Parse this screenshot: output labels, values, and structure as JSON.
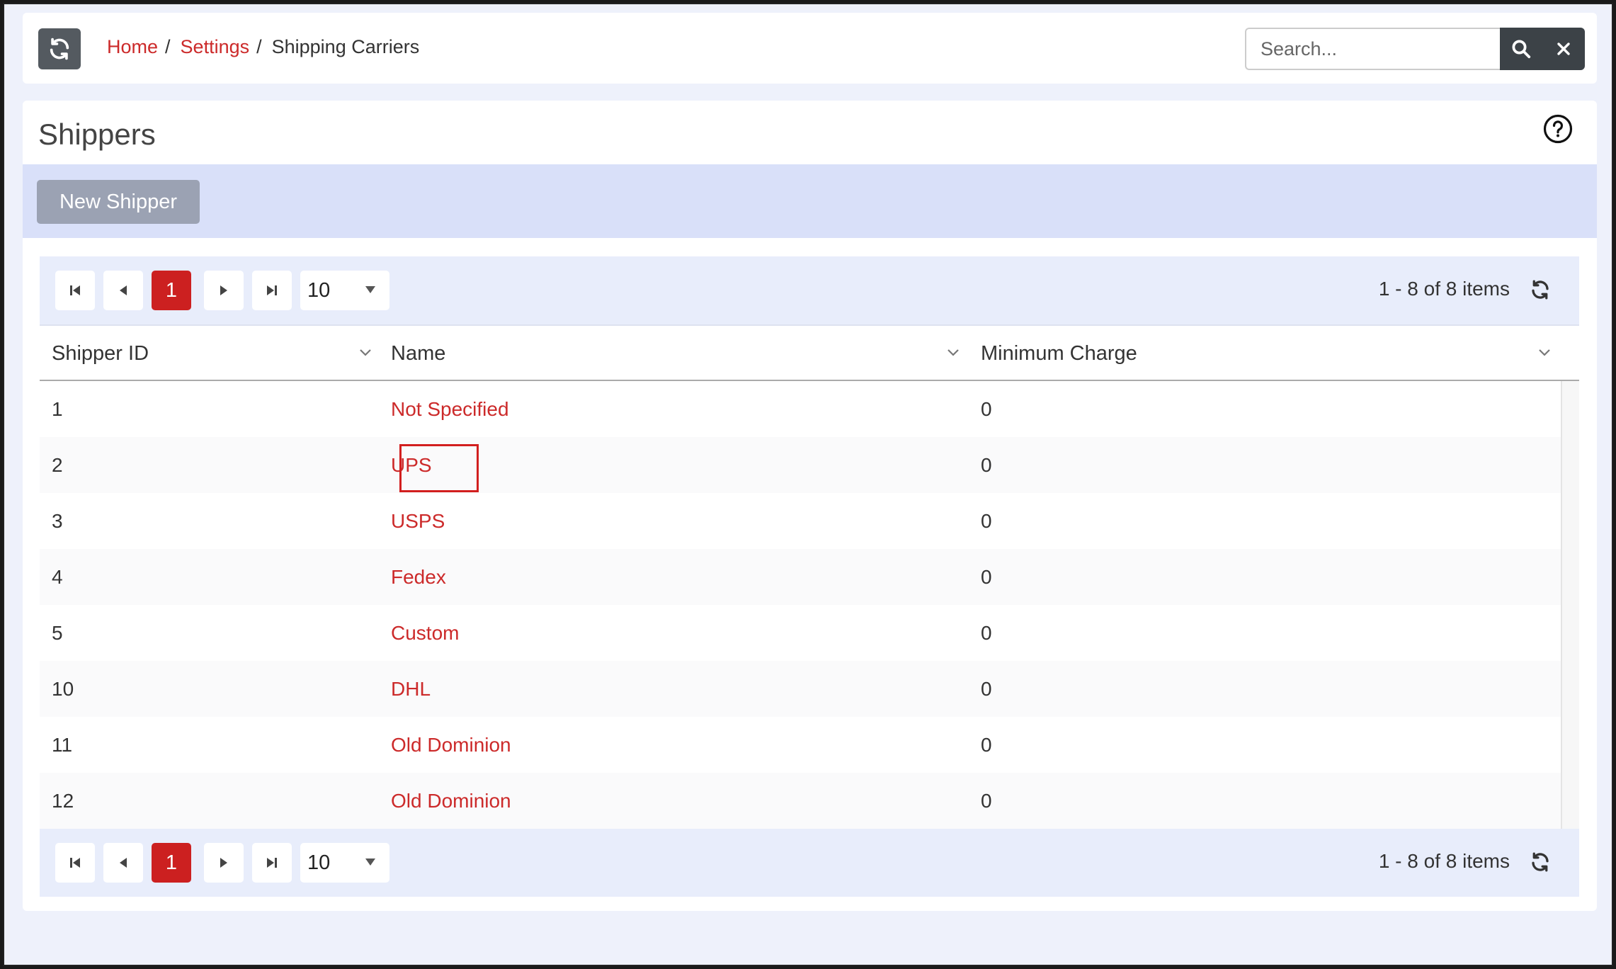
{
  "breadcrumb": {
    "home": "Home",
    "separator": "/",
    "settings": "Settings",
    "current": "Shipping Carriers"
  },
  "search": {
    "placeholder": "Search...",
    "value": ""
  },
  "page": {
    "title": "Shippers",
    "new_button": "New Shipper"
  },
  "pager": {
    "current_page": "1",
    "page_size": "10",
    "info": "1 - 8 of 8 items"
  },
  "columns": [
    "Shipper ID",
    "Name",
    "Minimum Charge"
  ],
  "rows": [
    {
      "id": "1",
      "name": "Not Specified",
      "charge": "0"
    },
    {
      "id": "2",
      "name": "UPS",
      "charge": "0"
    },
    {
      "id": "3",
      "name": "USPS",
      "charge": "0"
    },
    {
      "id": "4",
      "name": "Fedex",
      "charge": "0"
    },
    {
      "id": "5",
      "name": "Custom",
      "charge": "0"
    },
    {
      "id": "10",
      "name": "DHL",
      "charge": "0"
    },
    {
      "id": "11",
      "name": "Old Dominion",
      "charge": "0"
    },
    {
      "id": "12",
      "name": "Old Dominion",
      "charge": "0"
    }
  ],
  "colors": {
    "link": "#cc2a2a",
    "accent": "#cc2020",
    "toolbar": "#d9e0f9",
    "highlight": "#d21f1f"
  },
  "icons": {
    "refresh": "refresh-icon",
    "search": "search-icon",
    "clear": "close-icon",
    "help": "help-icon",
    "first": "first-page-icon",
    "prev": "prev-page-icon",
    "next": "next-page-icon",
    "last": "last-page-icon",
    "sort": "chevron-down-icon"
  }
}
